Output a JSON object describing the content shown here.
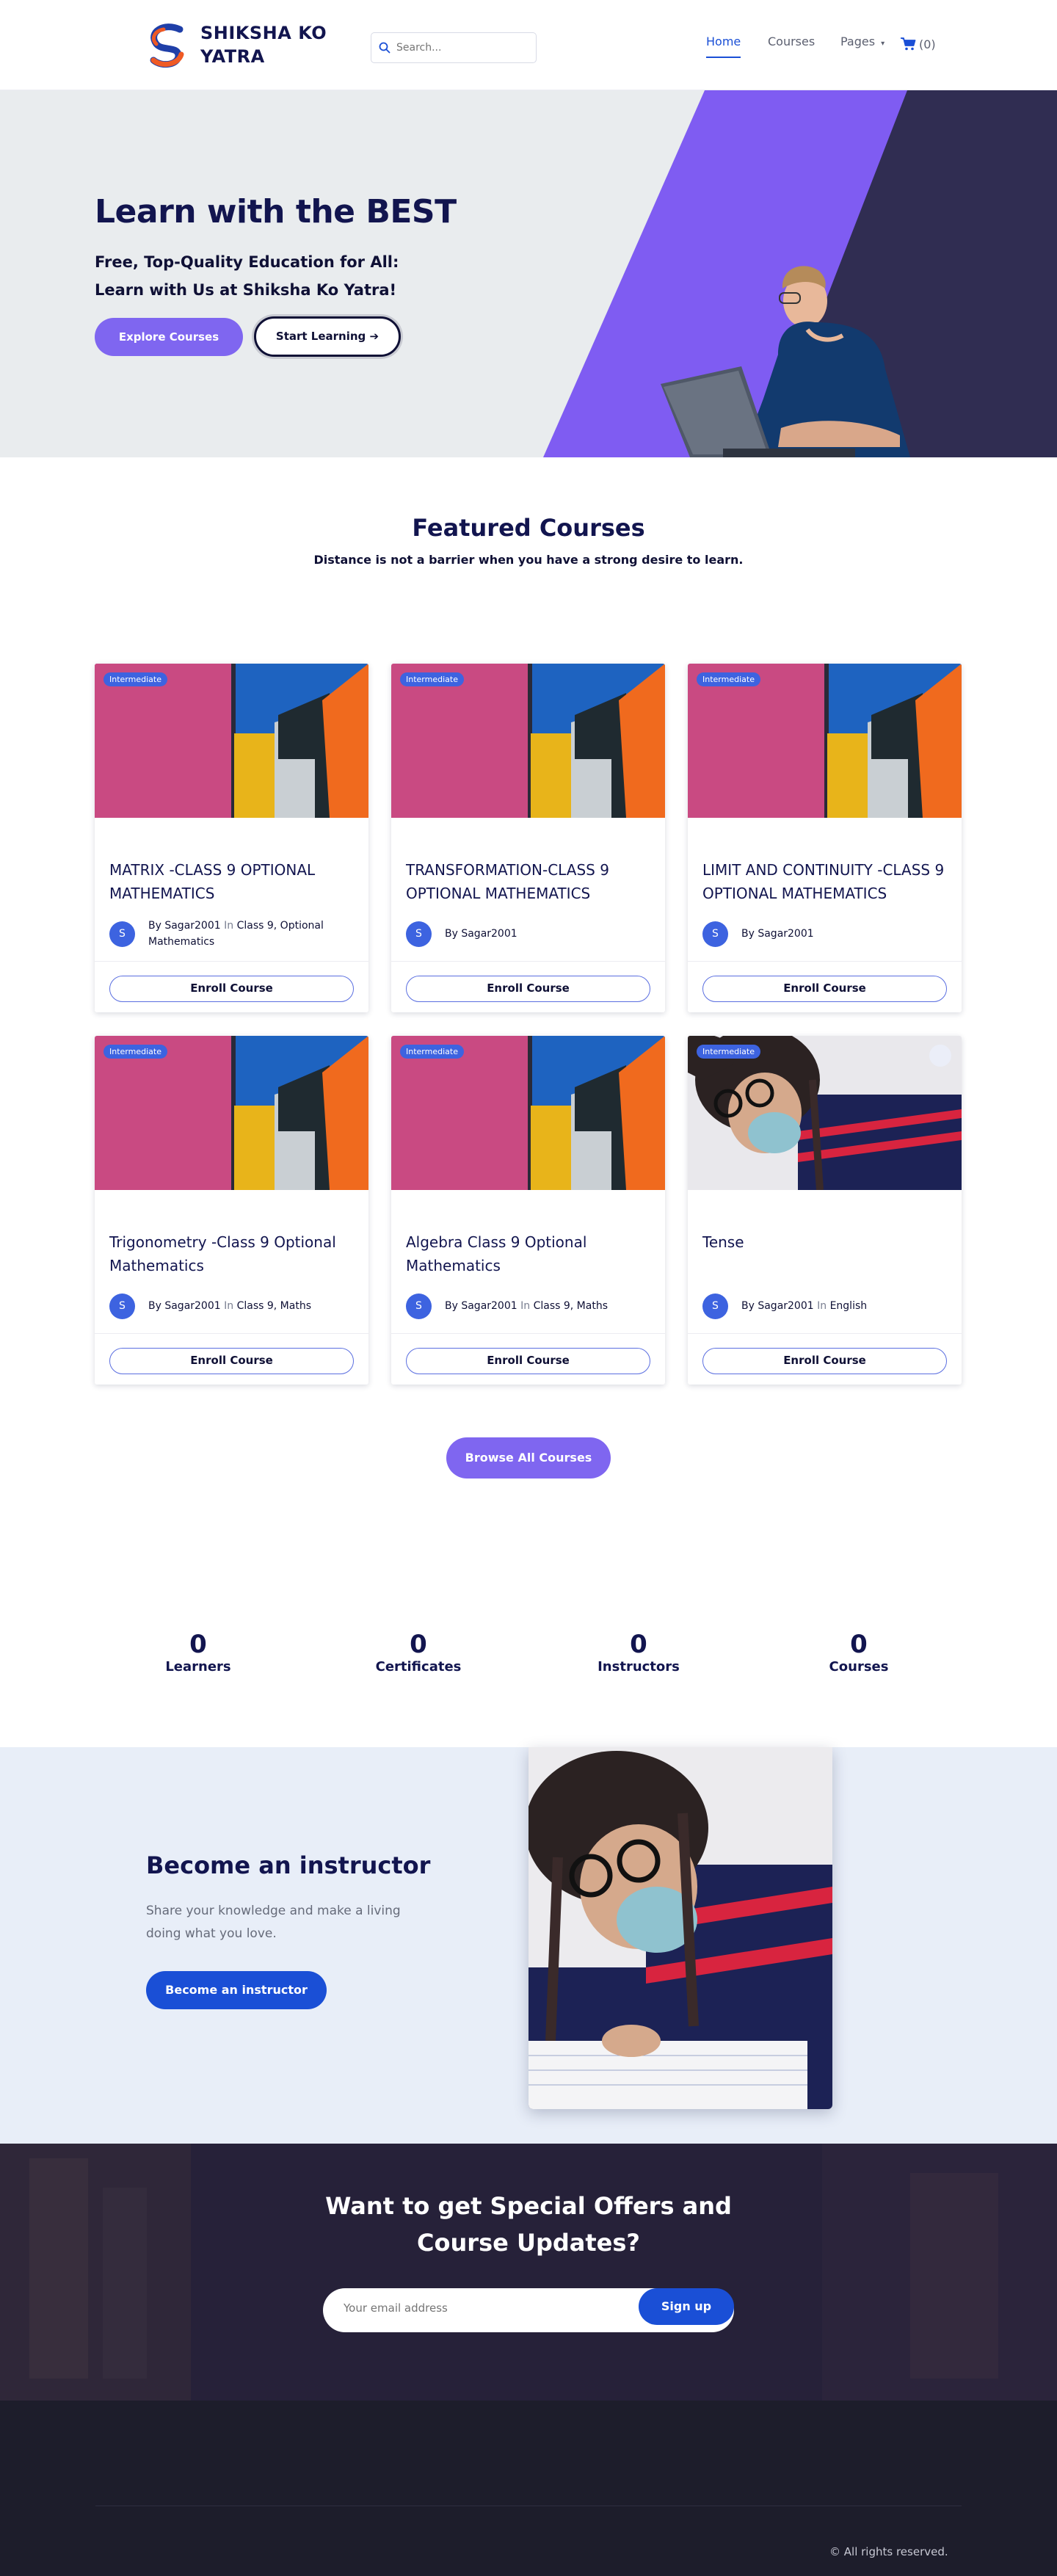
{
  "header": {
    "logo_text": "SHIKSHA KO YATRA",
    "search_placeholder": "Search...",
    "nav": {
      "home": "Home",
      "courses": "Courses",
      "pages": "Pages",
      "cart": "(0)"
    }
  },
  "hero": {
    "title": "Learn with the BEST",
    "subtitle": "Free, Top-Quality Education for All: Learn with Us at Shiksha Ko Yatra!",
    "explore_label": "Explore Courses",
    "start_label": "Start Learning"
  },
  "featured": {
    "title": "Featured Courses",
    "subtitle": "Distance is not a barrier when you have a strong desire to learn.",
    "courses": [
      {
        "badge": "Intermediate",
        "title": "MATRIX -CLASS 9 OPTIONAL MATHEMATICS",
        "by": "By Sagar2001",
        "in": "In",
        "category": "Class 9, Optional Mathematics",
        "avatar": "S",
        "enroll": "Enroll Course"
      },
      {
        "badge": "Intermediate",
        "title": "TRANSFORMATION-CLASS 9 OPTIONAL MATHEMATICS",
        "by": "By Sagar2001",
        "in": "",
        "category": "",
        "avatar": "S",
        "enroll": "Enroll Course"
      },
      {
        "badge": "Intermediate",
        "title": "LIMIT AND CONTINUITY -CLASS 9 OPTIONAL MATHEMATICS",
        "by": "By Sagar2001",
        "in": "",
        "category": "",
        "avatar": "S",
        "enroll": "Enroll Course"
      },
      {
        "badge": "Intermediate",
        "title": "Trigonometry -Class 9 Optional Mathematics",
        "by": "By Sagar2001",
        "in": "In",
        "category": "Class 9, Maths",
        "avatar": "S",
        "enroll": "Enroll Course"
      },
      {
        "badge": "Intermediate",
        "title": "Algebra Class 9 Optional Mathematics",
        "by": "By Sagar2001",
        "in": "In",
        "category": "Class 9, Maths",
        "avatar": "S",
        "enroll": "Enroll Course"
      },
      {
        "badge": "Intermediate",
        "title": "Tense",
        "by": "By Sagar2001",
        "in": "In",
        "category": "English",
        "avatar": "S",
        "enroll": "Enroll Course"
      }
    ],
    "browse_label": "Browse All Courses"
  },
  "stats": [
    {
      "value": "0",
      "label": "Learners"
    },
    {
      "value": "0",
      "label": "Certificates"
    },
    {
      "value": "0",
      "label": "Instructors"
    },
    {
      "value": "0",
      "label": "Courses"
    }
  ],
  "instructor": {
    "title": "Become an instructor",
    "text": "Share your knowledge and make a living doing what you love.",
    "button": "Become an instructor"
  },
  "newsletter": {
    "title": "Want to get Special Offers and Course Updates?",
    "placeholder": "Your email address",
    "button": "Sign up"
  },
  "footer": {
    "copyright": "© All rights reserved."
  },
  "colors": {
    "primary": "#7f66f0",
    "accent_blue": "#1a4fd6",
    "navy": "#12154f",
    "hero_dark": "#302d52"
  }
}
